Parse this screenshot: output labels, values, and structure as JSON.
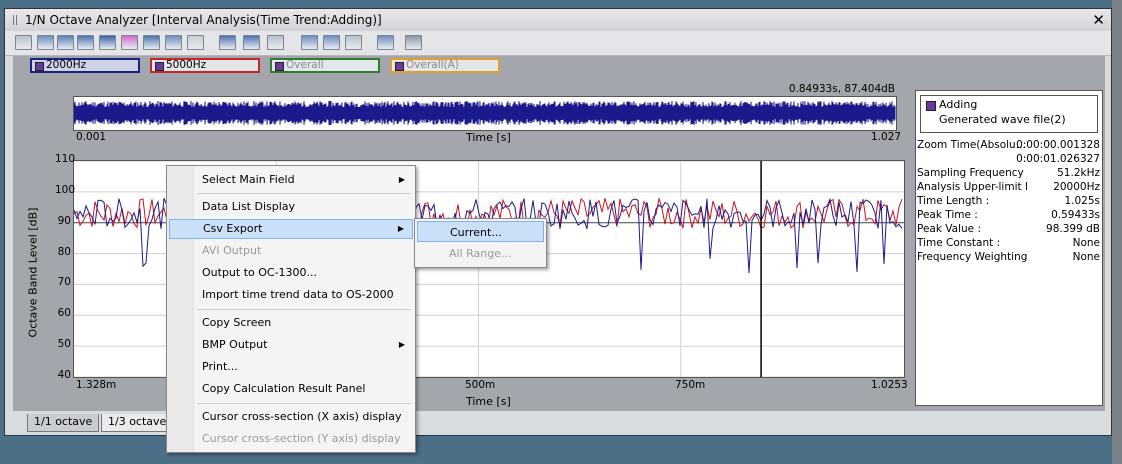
{
  "window": {
    "title": "1/N Octave Analyzer [Interval Analysis(Time Trend:Adding)]"
  },
  "toolbar": {
    "buttons": [
      "layout-icon",
      "bar-graph-icon",
      "spectrum-icon",
      "octave-icon",
      "time-trend-icon",
      "color-map-icon",
      "cursor-icon",
      "zoom-icon",
      "lock-icon",
      "display-mode-icon",
      "split-icon",
      "fit-icon",
      "overlay-icon",
      "window-icon",
      "scale-icon",
      "expand-icon",
      "settings-icon"
    ]
  },
  "legend": [
    {
      "label": "2000Hz",
      "color": "#1a237e",
      "active": true
    },
    {
      "label": "5000Hz",
      "color": "#c62828",
      "active": true
    },
    {
      "label": "Overall",
      "color": "#2e7d32",
      "active": false
    },
    {
      "label": "Overall(A)",
      "color": "#e0a030",
      "active": false
    }
  ],
  "waveform": {
    "cursor_readout": "0.84933s, 87.404dB",
    "x_start": "0.001",
    "x_end": "1.027",
    "x_label": "Time [s]"
  },
  "chart_data": {
    "type": "line",
    "xlabel": "Time [s]",
    "ylabel": "Octave Band Level [dB]",
    "ylim": [
      40,
      110
    ],
    "xlim": [
      0.001328,
      1.0253
    ],
    "y_ticks": [
      "110",
      "100",
      "90",
      "80",
      "70",
      "60",
      "50",
      "40"
    ],
    "x_ticks": [
      "1.328m",
      "500m",
      "750m",
      "1.0253"
    ],
    "cursor_x": 0.849,
    "series": [
      {
        "name": "2000Hz",
        "color": "#1a1a8c",
        "mean": 93,
        "min": 72,
        "max": 99
      },
      {
        "name": "5000Hz",
        "color": "#c8141e",
        "mean": 93,
        "min": 85,
        "max": 100
      }
    ]
  },
  "info_panel": {
    "legend_title": "Adding",
    "legend_source": "Generated wave file(2)",
    "rows": [
      {
        "k": "Zoom Time(Absolu...",
        "v": "0:00:00.001328"
      },
      {
        "k": "",
        "v": "0:00:01.026327"
      },
      {
        "k": "Sampling Frequency",
        "v": "51.2kHz"
      },
      {
        "k": "Analysis Upper-limit Freq...",
        "v": "20000Hz"
      },
      {
        "k": "Time Length :",
        "v": "1.025s"
      },
      {
        "k": "Peak Time :",
        "v": "0.59433s"
      },
      {
        "k": "Peak Value :",
        "v": "98.399 dB"
      },
      {
        "k": "Time Constant :",
        "v": "None"
      },
      {
        "k": "Frequency Weighting Correcti...",
        "v": "None"
      }
    ]
  },
  "tabs": [
    {
      "label": "1/1 octave"
    },
    {
      "label": "1/3 octave"
    }
  ],
  "context_menu": {
    "items": [
      {
        "label": "Select Main Field",
        "sub": true,
        "disabled": false
      },
      {
        "label": "Data List Display",
        "sub": false,
        "disabled": false
      },
      {
        "label": "Csv Export",
        "sub": true,
        "disabled": false,
        "highlight": true
      },
      {
        "label": "AVI Output",
        "sub": false,
        "disabled": true
      },
      {
        "label": "Output to OC-1300...",
        "sub": false,
        "disabled": false
      },
      {
        "label": "Import time trend data to OS-2000",
        "sub": false,
        "disabled": false
      },
      {
        "label": "Copy Screen",
        "sub": false,
        "disabled": false
      },
      {
        "label": "BMP Output",
        "sub": true,
        "disabled": false
      },
      {
        "label": "Print...",
        "sub": false,
        "disabled": false
      },
      {
        "label": "Copy Calculation Result Panel",
        "sub": false,
        "disabled": false
      },
      {
        "label": "Cursor cross-section (X axis) display",
        "sub": false,
        "disabled": false
      },
      {
        "label": "Cursor cross-section (Y axis) display",
        "sub": false,
        "disabled": true
      }
    ],
    "submenu": [
      {
        "label": "Current...",
        "disabled": false
      },
      {
        "label": "All Range...",
        "disabled": true
      }
    ]
  }
}
